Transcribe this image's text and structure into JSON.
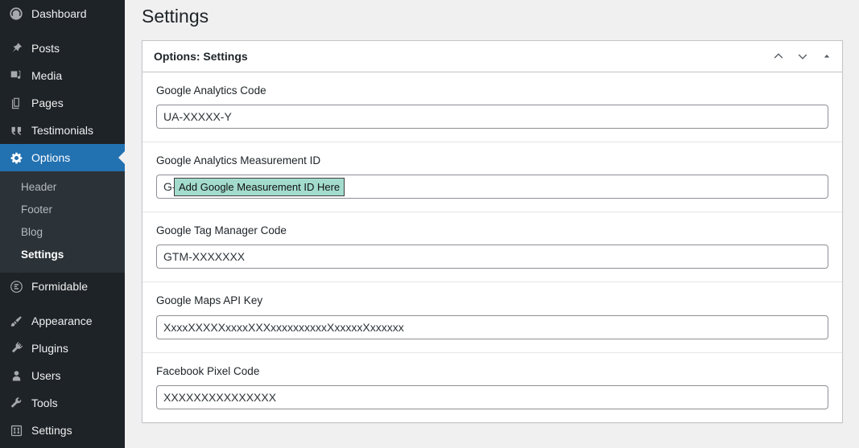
{
  "sidebar": {
    "items": [
      {
        "label": "Dashboard",
        "icon": "dashboard-icon",
        "name": "sidebar-item-dashboard",
        "active": false,
        "gap_after": true
      },
      {
        "label": "Posts",
        "icon": "pin-icon",
        "name": "sidebar-item-posts",
        "active": false,
        "gap_after": false
      },
      {
        "label": "Media",
        "icon": "media-icon",
        "name": "sidebar-item-media",
        "active": false,
        "gap_after": false
      },
      {
        "label": "Pages",
        "icon": "pages-icon",
        "name": "sidebar-item-pages",
        "active": false,
        "gap_after": false
      },
      {
        "label": "Testimonials",
        "icon": "quote-icon",
        "name": "sidebar-item-testimonials",
        "active": false,
        "gap_after": false
      },
      {
        "label": "Options",
        "icon": "gear-icon",
        "name": "sidebar-item-options",
        "active": true,
        "gap_after": false
      }
    ],
    "submenu": {
      "items": [
        {
          "label": "Header",
          "name": "submenu-item-header",
          "current": false
        },
        {
          "label": "Footer",
          "name": "submenu-item-footer",
          "current": false
        },
        {
          "label": "Blog",
          "name": "submenu-item-blog",
          "current": false
        },
        {
          "label": "Settings",
          "name": "submenu-item-settings",
          "current": true
        }
      ]
    },
    "items_lower": [
      {
        "label": "Formidable",
        "icon": "formidable-icon",
        "name": "sidebar-item-formidable",
        "active": false,
        "gap_after": true
      },
      {
        "label": "Appearance",
        "icon": "brush-icon",
        "name": "sidebar-item-appearance",
        "active": false,
        "gap_after": false
      },
      {
        "label": "Plugins",
        "icon": "plug-icon",
        "name": "sidebar-item-plugins",
        "active": false,
        "gap_after": false
      },
      {
        "label": "Users",
        "icon": "user-icon",
        "name": "sidebar-item-users",
        "active": false,
        "gap_after": false
      },
      {
        "label": "Tools",
        "icon": "wrench-icon",
        "name": "sidebar-item-tools",
        "active": false,
        "gap_after": false
      },
      {
        "label": "Settings",
        "icon": "sliders-icon",
        "name": "sidebar-item-settings",
        "active": false,
        "gap_after": false
      }
    ],
    "colors": {
      "background": "#1d2327",
      "submenu_background": "#2c3338",
      "active_background": "#2271b1",
      "text": "#f0f0f1",
      "muted_text": "#b4b9be"
    }
  },
  "main": {
    "page_title": "Settings",
    "panel": {
      "title": "Options: Settings",
      "controls": [
        {
          "name": "move-up-button",
          "icon": "chevron-up-icon"
        },
        {
          "name": "move-down-button",
          "icon": "chevron-down-icon"
        },
        {
          "name": "toggle-panel-button",
          "icon": "triangle-up-icon"
        }
      ],
      "fields": [
        {
          "label": "Google Analytics Code",
          "value": "UA-XXXXX-Y",
          "name": "google-analytics-code-input",
          "annotation": null
        },
        {
          "label": "Google Analytics Measurement ID",
          "value": "G-",
          "name": "google-analytics-measurement-id-input",
          "annotation": {
            "text": "Add Google Measurement ID Here",
            "background": "#a3dccd",
            "border": "#3c3c3c"
          }
        },
        {
          "label": "Google Tag Manager Code",
          "value": "GTM-XXXXXXX",
          "name": "google-tag-manager-code-input",
          "annotation": null
        },
        {
          "label": "Google Maps API Key",
          "value": "XxxxXXXXXxxxxXXXxxxxxxxxxxXxxxxxXxxxxxx",
          "name": "google-maps-api-key-input",
          "annotation": null
        },
        {
          "label": "Facebook Pixel Code",
          "value": "XXXXXXXXXXXXXXX",
          "name": "facebook-pixel-code-input",
          "annotation": null
        }
      ]
    }
  }
}
